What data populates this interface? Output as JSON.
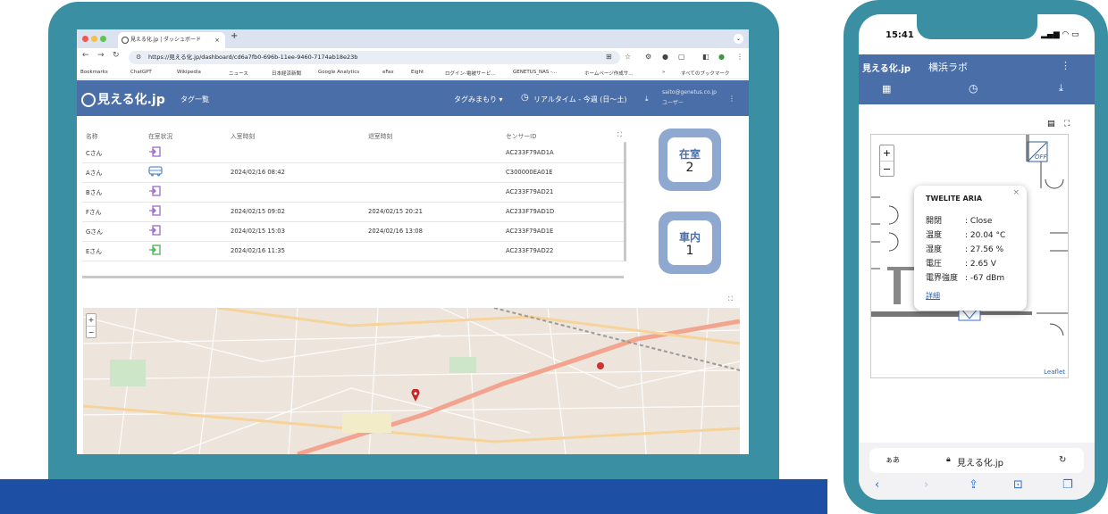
{
  "browser": {
    "tab_title": "見える化.jp | ダッシュボード",
    "tab_close": "×",
    "new_tab": "+",
    "url": "https://見える化.jp/dashboard/cd6a7fb0-696b-11ee-9460-7174ab18e23b",
    "bookmarks": [
      "Bookmarks",
      "ChatGPT",
      "Wikipedia",
      "ニュース",
      "日本経済新聞",
      "Google Analytics",
      "eFax",
      "Eight",
      "ログイン-電被サービ...",
      "GENETUS_NAS -...",
      "ホームページ作成サ...",
      "»",
      "すべてのブックマーク"
    ]
  },
  "app": {
    "logo": "見える化.jp",
    "nav_title": "タグ一覧",
    "user_select": "タグみまもり ▾",
    "period": "リアルタイム - 今週 (日〜土)",
    "email": "saito@genetus.co.jp",
    "role": "ユーザー",
    "menu": "⋮"
  },
  "table": {
    "columns": [
      "名称",
      "在室状況",
      "入室時刻",
      "退室時刻",
      "センサーID"
    ],
    "rows": [
      {
        "name": "Cさん",
        "status": "enter",
        "in": "",
        "out": "",
        "id": "AC233F79AD1A"
      },
      {
        "name": "Aさん",
        "status": "vehicle",
        "in": "2024/02/16 08:42",
        "out": "",
        "id": "C300000EA01E"
      },
      {
        "name": "Bさん",
        "status": "enter",
        "in": "",
        "out": "",
        "id": "AC233F79AD21"
      },
      {
        "name": "Fさん",
        "status": "enter",
        "in": "2024/02/15 09:02",
        "out": "2024/02/15 20:21",
        "id": "AC233F79AD1D"
      },
      {
        "name": "Gさん",
        "status": "enter",
        "in": "2024/02/15 15:03",
        "out": "2024/02/16 13:08",
        "id": "AC233F79AD1E"
      },
      {
        "name": "Eさん",
        "status": "present",
        "in": "2024/02/16 11:35",
        "out": "",
        "id": "AC233F79AD22"
      }
    ]
  },
  "stats": {
    "room_label": "在室",
    "room_count": "2",
    "car_label": "車内",
    "car_count": "1"
  },
  "map": {
    "zoom_in": "+",
    "zoom_out": "−"
  },
  "phone": {
    "time": "15:41",
    "app_logo": "見える化.jp",
    "location": "横浜ラボ",
    "floor_zoom_in": "+",
    "floor_zoom_out": "−",
    "attribution": "Leaflet",
    "popup": {
      "title": "TWELITE ARIA",
      "close": "×",
      "rows": [
        {
          "k": "開閉",
          "v": ": Close"
        },
        {
          "k": "温度",
          "v": ": 20.04 °C"
        },
        {
          "k": "湿度",
          "v": ": 27.56 %"
        },
        {
          "k": "電圧",
          "v": ": 2.65 V"
        },
        {
          "k": "電界強度",
          "v": ": -67 dBm"
        }
      ],
      "link": "詳細"
    },
    "door_status": "OFF",
    "aa": "ぁあ",
    "address": "見える化.jp"
  },
  "colors": {
    "frame": "#3a8fa3",
    "header": "#4a6ea8",
    "stand": "#1d50a4",
    "stat_bg": "#8fa8cf"
  }
}
